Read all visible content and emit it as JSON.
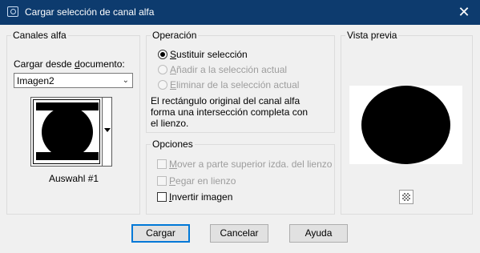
{
  "window": {
    "title": "Cargar selección de canal alfa",
    "close_glyph": "✕"
  },
  "canales": {
    "group_label": "Canales alfa",
    "load_from_prefix": "Cargar desde ",
    "load_from_accel": "d",
    "load_from_suffix": "ocumento:",
    "document_value": "Imagen2",
    "thumb_caption": "Auswahl #1"
  },
  "operacion": {
    "group_label": "Operación",
    "options": [
      {
        "accel": "S",
        "rest": "ustituir selección",
        "selected": true,
        "enabled": true
      },
      {
        "accel": "A",
        "rest": "ñadir a la selección actual",
        "selected": false,
        "enabled": false
      },
      {
        "accel": "E",
        "rest": "liminar de la selección actual",
        "selected": false,
        "enabled": false
      }
    ],
    "note_line1": "El rectángulo original del canal alfa",
    "note_line2": "forma una intersección completa con",
    "note_line3": "el lienzo."
  },
  "opciones": {
    "group_label": "Opciones",
    "items": [
      {
        "accel": "M",
        "rest": "over a parte superior izda. del lienzo",
        "checked": false,
        "enabled": false
      },
      {
        "accel": "P",
        "rest": "egar en lienzo",
        "checked": false,
        "enabled": false
      },
      {
        "accel": "I",
        "rest": "nvertir imagen",
        "checked": false,
        "enabled": true
      }
    ]
  },
  "vista_previa": {
    "group_label": "Vista previa"
  },
  "buttons": {
    "ok": "Cargar",
    "cancel": "Cancelar",
    "help": "Ayuda"
  },
  "colors": {
    "titlebar": "#0d3b6e",
    "dialog_bg": "#f0f0f0",
    "default_button_border": "#0078d7"
  },
  "icons": {
    "app": "selection-icon",
    "close": "close-icon",
    "dropdown": "chevron-down-icon",
    "zoom": "zoom-checker-icon"
  }
}
